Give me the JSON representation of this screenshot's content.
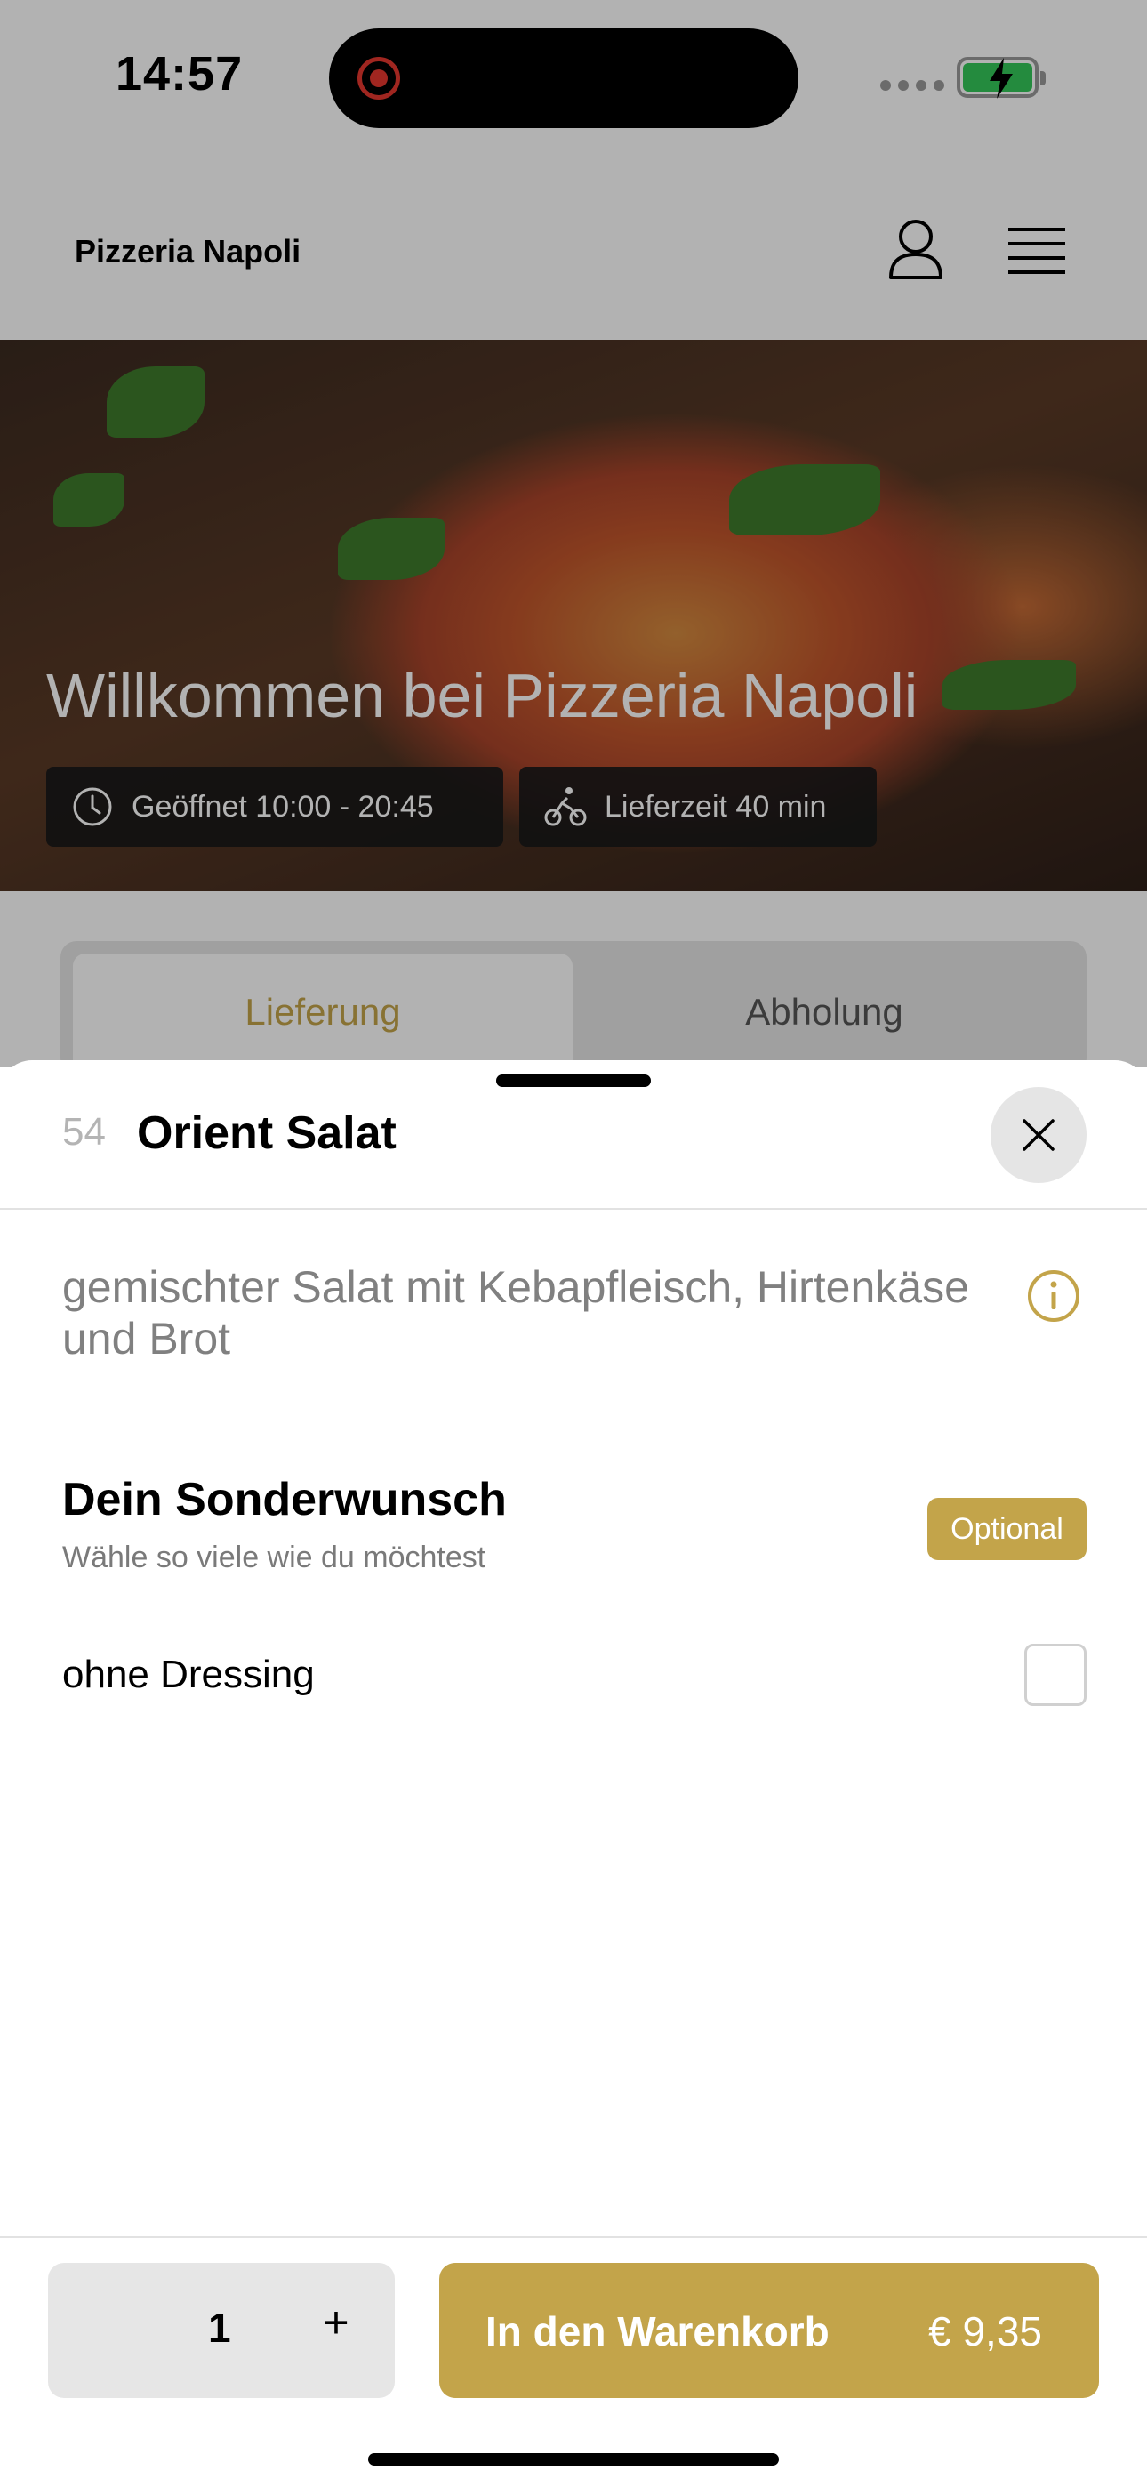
{
  "status_bar": {
    "time": "14:57"
  },
  "header": {
    "brand": "Pizzeria Napoli"
  },
  "hero": {
    "title": "Willkommen bei Pizzeria Napoli",
    "opening": "Geöffnet 10:00 - 20:45",
    "delivery_time": "Lieferzeit 40 min"
  },
  "tabs": [
    {
      "label": "Lieferung",
      "active": true
    },
    {
      "label": "Abholung",
      "active": false
    }
  ],
  "sheet": {
    "item_number": "54",
    "item_name": "Orient Salat",
    "description": "gemischter Salat mit Kebapfleisch, Hirtenkäse und Brot",
    "section": {
      "title": "Dein Sonderwunsch",
      "subtitle": "Wähle so viele wie du möchtest",
      "badge": "Optional",
      "options": [
        {
          "label": "ohne Dressing",
          "checked": false
        }
      ]
    },
    "quantity": "1",
    "plus_label": "+",
    "cart_label": "In den Warenkorb",
    "price": "€ 9,35"
  },
  "colors": {
    "accent": "#c3a44a",
    "battery": "#34c759",
    "record": "#e5372e"
  },
  "icons": [
    "record-icon",
    "battery-icon",
    "user-icon",
    "menu-icon",
    "clock-icon",
    "bike-icon",
    "close-icon",
    "info-icon"
  ]
}
